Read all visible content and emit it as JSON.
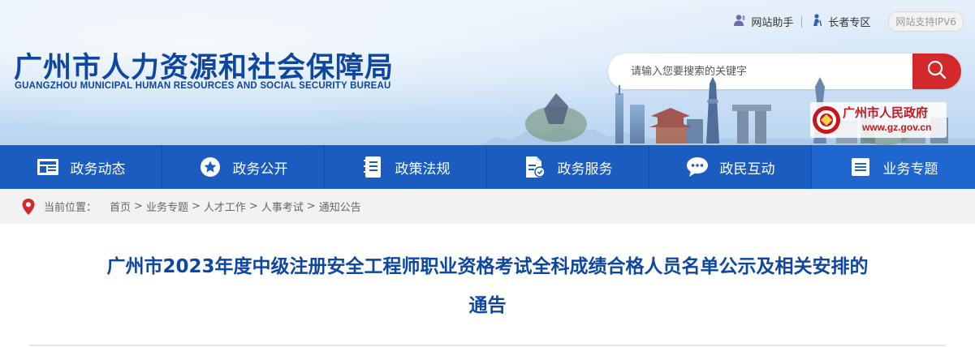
{
  "top_links": {
    "assistant": "网站助手",
    "elderly": "长者专区",
    "ipv6": "网站支持IPV6"
  },
  "logo": {
    "cn": "广州市人力资源和社会保障局",
    "en": "GUANGZHOU MUNICIPAL HUMAN RESOURCES AND SOCIAL SECURITY BUREAU"
  },
  "search": {
    "placeholder": "请输入您要搜索的关键字",
    "button_icon": "search-icon"
  },
  "gov_badge": {
    "name": "广州市人民政府",
    "url": "www.gz.gov.cn"
  },
  "nav": {
    "items": [
      {
        "label": "政务动态",
        "icon": "news-icon"
      },
      {
        "label": "政务公开",
        "icon": "star-icon"
      },
      {
        "label": "政策法规",
        "icon": "book-icon"
      },
      {
        "label": "政务服务",
        "icon": "document-edit-icon"
      },
      {
        "label": "政民互动",
        "icon": "chat-icon"
      },
      {
        "label": "业务专题",
        "icon": "list-icon"
      }
    ],
    "active_index": 5
  },
  "breadcrumb": {
    "label": "当前位置：",
    "items": [
      "首页",
      "业务专题",
      "人才工作",
      "人事考试",
      "通知公告"
    ],
    "separator": ">"
  },
  "article": {
    "title_line1": "广州市2023年度中级注册安全工程师职业资格考试全科成绩合格人员名单公示及相关安排的",
    "title_line2": "通告"
  },
  "colors": {
    "brand_blue": "#0d47a1",
    "nav_blue": "#1a5cc0",
    "search_red": "#d3292d",
    "gov_red": "#c8161d",
    "crumb_bg": "#f2f2f2"
  }
}
